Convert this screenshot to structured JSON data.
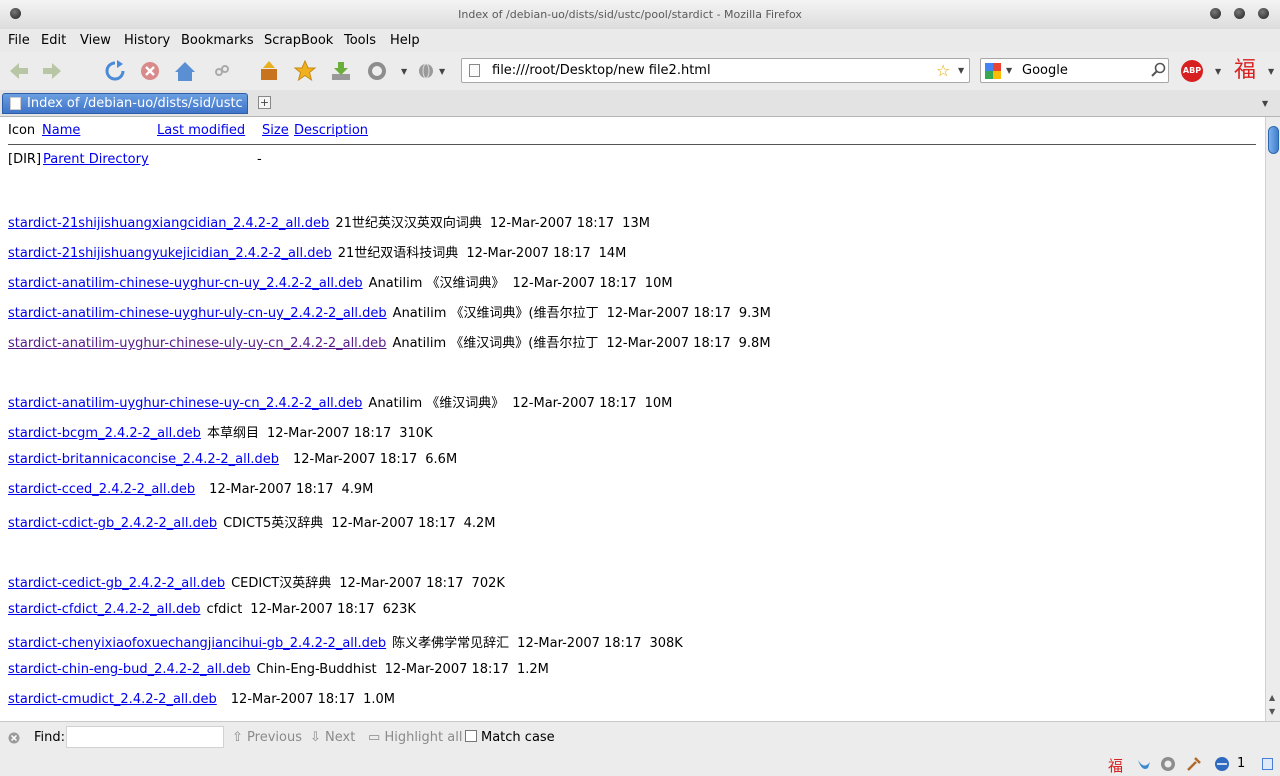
{
  "window": {
    "title": "Index of /debian-uo/dists/sid/ustc/pool/stardict - Mozilla Firefox"
  },
  "menu": [
    "File",
    "Edit",
    "View",
    "History",
    "Bookmarks",
    "ScrapBook",
    "Tools",
    "Help"
  ],
  "url": "file:///root/Desktop/new file2.html",
  "search": {
    "engine": "Google"
  },
  "tab": {
    "label": "Index of /debian-uo/dists/sid/ustc/..."
  },
  "table": {
    "headers": {
      "icon": "Icon",
      "name": "Name",
      "modified": "Last modified",
      "size": "Size",
      "description": "Description"
    },
    "parent": {
      "icon": "[DIR]",
      "name": "Parent Directory",
      "size": "-"
    },
    "rows": [
      {
        "name": "stardict-21shijishuangxiangcidian_2.4.2-2_all.deb",
        "desc": "21世纪英汉汉英双向词典",
        "date": "12-Mar-2007 18:17",
        "size": "13M"
      },
      {
        "name": "stardict-21shijishuangyukejicidian_2.4.2-2_all.deb",
        "desc": "21世纪双语科技词典",
        "date": "12-Mar-2007 18:17",
        "size": "14M"
      },
      {
        "name": "stardict-anatilim-chinese-uyghur-cn-uy_2.4.2-2_all.deb",
        "desc": "Anatilim 《汉维词典》",
        "date": "12-Mar-2007 18:17",
        "size": "10M"
      },
      {
        "name": "stardict-anatilim-chinese-uyghur-uly-cn-uy_2.4.2-2_all.deb",
        "desc": "Anatilim 《汉维词典》(维吾尔拉丁",
        "date": "12-Mar-2007 18:17",
        "size": "9.3M"
      },
      {
        "name": "stardict-anatilim-uyghur-chinese-uly-uy-cn_2.4.2-2_all.deb",
        "desc": "Anatilim 《维汉词典》(维吾尔拉丁",
        "date": "12-Mar-2007 18:17",
        "size": "9.8M",
        "visited": true
      },
      {
        "name": "stardict-anatilim-uyghur-chinese-uy-cn_2.4.2-2_all.deb",
        "desc": "Anatilim 《维汉词典》",
        "date": "12-Mar-2007 18:17",
        "size": "10M"
      },
      {
        "name": "stardict-bcgm_2.4.2-2_all.deb",
        "desc": "本草纲目",
        "date": "12-Mar-2007 18:17",
        "size": "310K"
      },
      {
        "name": "stardict-britannicaconcise_2.4.2-2_all.deb",
        "desc": "",
        "date": "12-Mar-2007 18:17",
        "size": "6.6M"
      },
      {
        "name": "stardict-cced_2.4.2-2_all.deb",
        "desc": "",
        "date": "12-Mar-2007 18:17",
        "size": "4.9M"
      },
      {
        "name": "stardict-cdict-gb_2.4.2-2_all.deb",
        "desc": "CDICT5英汉辞典",
        "date": "12-Mar-2007 18:17",
        "size": "4.2M"
      },
      {
        "name": "stardict-cedict-gb_2.4.2-2_all.deb",
        "desc": "CEDICT汉英辞典",
        "date": "12-Mar-2007 18:17",
        "size": "702K"
      },
      {
        "name": "stardict-cfdict_2.4.2-2_all.deb",
        "desc": "cfdict",
        "date": "12-Mar-2007 18:17",
        "size": "623K"
      },
      {
        "name": "stardict-chenyixiaofoxuechangjiancihui-gb_2.4.2-2_all.deb",
        "desc": "陈义孝佛学常见辞汇",
        "date": "12-Mar-2007 18:17",
        "size": "308K"
      },
      {
        "name": "stardict-chin-eng-bud_2.4.2-2_all.deb",
        "desc": "Chin-Eng-Buddhist",
        "date": "12-Mar-2007 18:17",
        "size": "1.2M"
      },
      {
        "name": "stardict-cmudict_2.4.2-2_all.deb",
        "desc": "",
        "date": "12-Mar-2007 18:17",
        "size": "1.0M"
      }
    ]
  },
  "findbar": {
    "find_label": "Find:",
    "previous": "Previous",
    "next": "Next",
    "highlight": "Highlight all",
    "match_case": "Match case"
  },
  "status": {
    "count": "1"
  },
  "colors": {
    "link": "#0000ee",
    "visited": "#551a8b",
    "tab": "#4a80d4"
  }
}
